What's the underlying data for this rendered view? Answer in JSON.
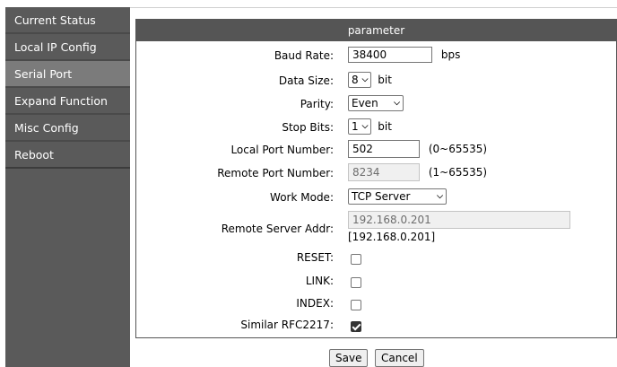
{
  "sidebar": {
    "items": [
      {
        "label": "Current Status"
      },
      {
        "label": "Local IP Config"
      },
      {
        "label": "Serial Port"
      },
      {
        "label": "Expand Function"
      },
      {
        "label": "Misc Config"
      },
      {
        "label": "Reboot"
      }
    ],
    "active_index": 2
  },
  "panel": {
    "title": "parameter",
    "baud_rate": {
      "label": "Baud Rate:",
      "value": "38400",
      "unit": "bps"
    },
    "data_size": {
      "label": "Data Size:",
      "value": "8",
      "unit": "bit"
    },
    "parity": {
      "label": "Parity:",
      "value": "Even"
    },
    "stop_bits": {
      "label": "Stop Bits:",
      "value": "1",
      "unit": "bit"
    },
    "local_port": {
      "label": "Local Port Number:",
      "value": "502",
      "range": "(0~65535)"
    },
    "remote_port": {
      "label": "Remote Port Number:",
      "value": "8234",
      "range": "(1~65535)"
    },
    "work_mode": {
      "label": "Work Mode:",
      "value": "TCP Server"
    },
    "remote_server": {
      "label": "Remote Server Addr:",
      "value": "192.168.0.201",
      "echo": "[192.168.0.201]"
    },
    "reset": {
      "label": "RESET:",
      "checked": false
    },
    "link": {
      "label": "LINK:",
      "checked": false
    },
    "index": {
      "label": "INDEX:",
      "checked": false
    },
    "rfc2217": {
      "label": "Similar RFC2217:",
      "checked": true
    }
  },
  "buttons": {
    "save": "Save",
    "cancel": "Cancel"
  },
  "colors": {
    "sidebar_bg": "#5a5a5a",
    "sidebar_active": "#7b7b7b",
    "header_bg": "#555555"
  }
}
